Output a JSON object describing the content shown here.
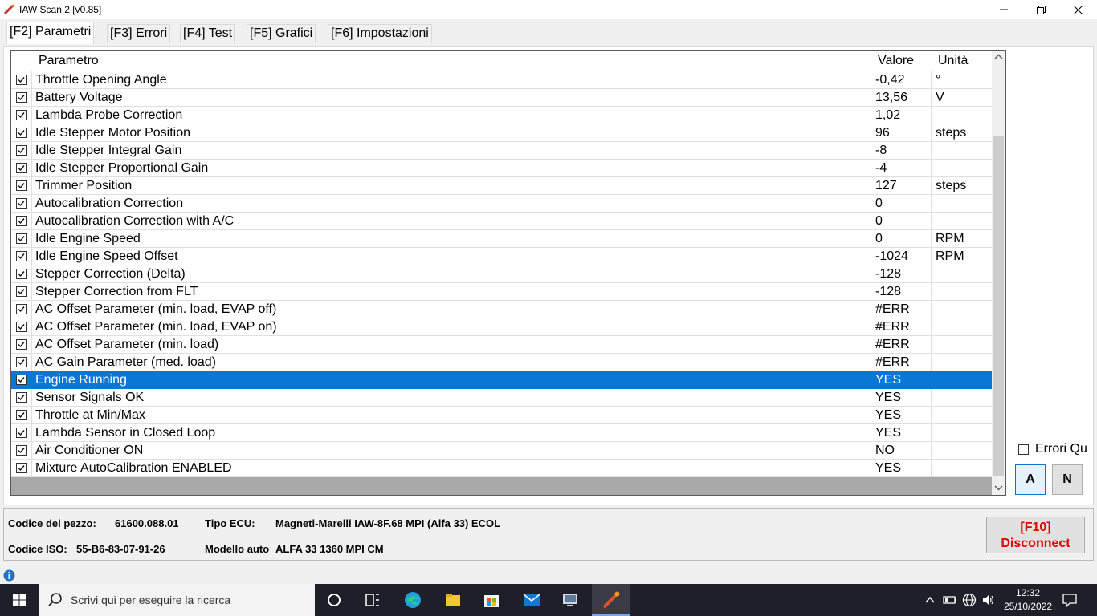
{
  "window": {
    "title": "IAW Scan 2 [v0.85]"
  },
  "tabs": [
    {
      "label": "[F2] Parametri"
    },
    {
      "label": "[F3] Errori"
    },
    {
      "label": "[F4] Test"
    },
    {
      "label": "[F5] Grafici"
    },
    {
      "label": "[F6] Impostazioni"
    }
  ],
  "grid": {
    "columns": {
      "name": "Parametro",
      "value": "Valore",
      "unit": "Unità"
    },
    "rows": [
      {
        "name": "Throttle Opening Angle",
        "value": "-0,42",
        "unit": "°",
        "checked": true
      },
      {
        "name": "Battery Voltage",
        "value": "13,56",
        "unit": "V",
        "checked": true
      },
      {
        "name": "Lambda Probe Correction",
        "value": "1,02",
        "unit": "",
        "checked": true
      },
      {
        "name": "Idle Stepper Motor Position",
        "value": "96",
        "unit": "steps",
        "checked": true
      },
      {
        "name": "Idle Stepper Integral Gain",
        "value": "-8",
        "unit": "",
        "checked": true
      },
      {
        "name": "Idle Stepper Proportional Gain",
        "value": "-4",
        "unit": "",
        "checked": true
      },
      {
        "name": "Trimmer Position",
        "value": "127",
        "unit": "steps",
        "checked": true
      },
      {
        "name": "Autocalibration Correction",
        "value": "0",
        "unit": "",
        "checked": true
      },
      {
        "name": "Autocalibration Correction with A/C",
        "value": "0",
        "unit": "",
        "checked": true
      },
      {
        "name": "Idle Engine Speed",
        "value": "0",
        "unit": "RPM",
        "checked": true
      },
      {
        "name": "Idle Engine Speed Offset",
        "value": "-1024",
        "unit": "RPM",
        "checked": true
      },
      {
        "name": "Stepper Correction (Delta)",
        "value": "-128",
        "unit": "",
        "checked": true
      },
      {
        "name": "Stepper Correction from FLT",
        "value": "-128",
        "unit": "",
        "checked": true
      },
      {
        "name": "AC Offset Parameter (min. load, EVAP off)",
        "value": "#ERR",
        "unit": "",
        "checked": true
      },
      {
        "name": "AC Offset Parameter (min. load, EVAP on)",
        "value": "#ERR",
        "unit": "",
        "checked": true
      },
      {
        "name": "AC Offset Parameter (min. load)",
        "value": "#ERR",
        "unit": "",
        "checked": true
      },
      {
        "name": "AC Gain Parameter (med. load)",
        "value": "#ERR",
        "unit": "",
        "checked": true
      },
      {
        "name": "Engine Running",
        "value": "YES",
        "unit": "",
        "checked": true,
        "selected": true
      },
      {
        "name": "Sensor Signals OK",
        "value": "YES",
        "unit": "",
        "checked": true
      },
      {
        "name": "Throttle at Min/Max",
        "value": "YES",
        "unit": "",
        "checked": true
      },
      {
        "name": "Lambda Sensor in Closed Loop",
        "value": "YES",
        "unit": "",
        "checked": true
      },
      {
        "name": "Air Conditioner ON",
        "value": "NO",
        "unit": "",
        "checked": true
      },
      {
        "name": "Mixture AutoCalibration ENABLED",
        "value": "YES",
        "unit": "",
        "checked": true
      }
    ]
  },
  "side": {
    "errori_label": "Errori Qu",
    "btn_a": "A",
    "btn_n": "N"
  },
  "info": {
    "part_code_label": "Codice del pezzo:",
    "part_code": "61600.088.01",
    "ecu_type_label": "Tipo ECU:",
    "ecu_type": "Magneti-Marelli IAW-8F.68 MPI (Alfa 33) ECOL",
    "iso_code_label": "Codice ISO:",
    "iso_code": "55-B6-83-07-91-26",
    "model_label": "Modello auto",
    "model": "ALFA 33 1360 MPI CM",
    "disconnect_key": "[F10]",
    "disconnect_label": "Disconnect"
  },
  "taskbar": {
    "search_placeholder": "Scrivi qui per eseguire la ricerca",
    "time": "12:32",
    "date": "25/10/2022"
  },
  "colors": {
    "selection": "#0a77d5",
    "disconnect": "#e00000"
  }
}
